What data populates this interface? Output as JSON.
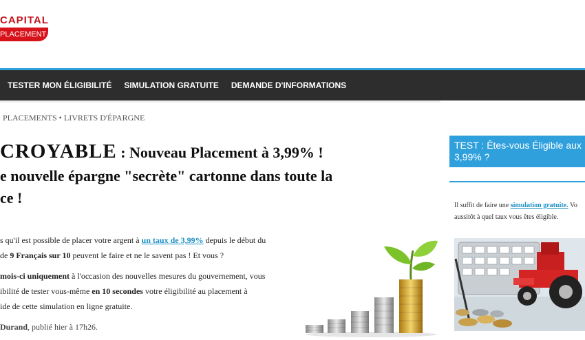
{
  "logo": {
    "top": "CAPITAL",
    "bottom": "PLACEMENT"
  },
  "nav": {
    "items": [
      "TESTER MON ÉLIGIBILITÉ",
      "SIMULATION GRATUITE",
      "DEMANDE D'INFORMATIONS"
    ]
  },
  "breadcrumb": "PLACEMENTS • LIVRETS D'ÉPARGNE",
  "headline": {
    "big": "CROYABLE",
    "rest": " : Nouveau Placement à 3,99% !",
    "sub_line1": "e nouvelle épargne \"secrète\" cartonne dans toute la",
    "sub_line2": "ce !"
  },
  "article": {
    "p1_a": "s qu'il est possible de placer votre argent à ",
    "p1_link": "un taux de 3,99%",
    "p1_b": " depuis le début du",
    "p1_c": " de ",
    "p1_bold": "9 Français sur 10",
    "p1_d": " peuvent le faire et ne le savent pas ! Et vous ?",
    "p2_bold": "mois-ci uniquement",
    "p2_a": " à l'occasion des nouvelles mesures du gouvernement, vous",
    "p2_b": "ibilité de tester vous-même ",
    "p2_bold2": "en 10 secondes",
    "p2_c": " votre éligibilité au placement à",
    "p2_d": "ide de cette simulation en ligne gratuite.",
    "author_bold": "Durand",
    "author_rest": ", publié hier à 17h26."
  },
  "sidebar": {
    "box_line1": "TEST : Êtes-vous Éligible aux",
    "box_line2": "3,99% ?",
    "text_a": "Il suffit de faire une ",
    "text_link": "simulation gratuite.",
    "text_b": " Vo",
    "text_c": "aussitôt à quel taux vous êtes éligible."
  },
  "colors": {
    "accent": "#2fa0dc",
    "brand_red": "#d8121b",
    "nav_bg": "#2d2d2d",
    "link": "#1b8fc5"
  }
}
